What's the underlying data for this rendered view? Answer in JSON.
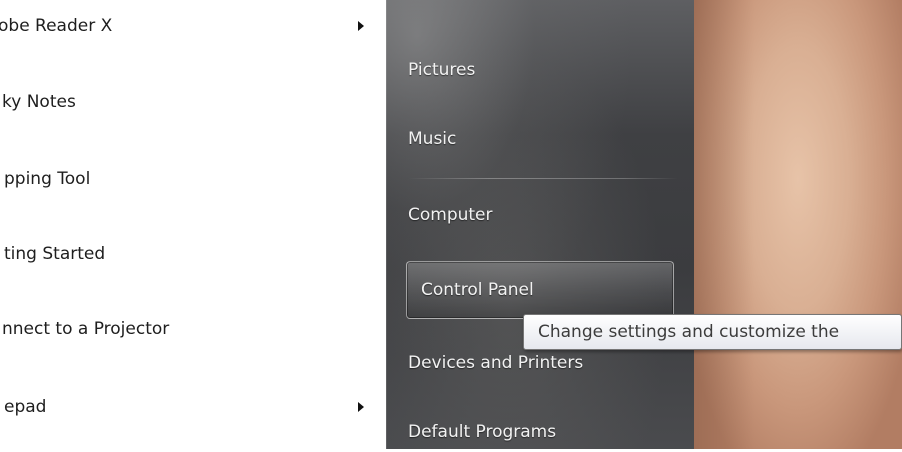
{
  "programs": {
    "items": [
      {
        "label": "obe Reader X",
        "has_submenu": true
      },
      {
        "label": "ky Notes",
        "has_submenu": false
      },
      {
        "label": "pping Tool",
        "has_submenu": false
      },
      {
        "label": "ting Started",
        "has_submenu": false
      },
      {
        "label": "nnect to a Projector",
        "has_submenu": false
      },
      {
        "label": "epad",
        "has_submenu": true
      }
    ]
  },
  "places": {
    "items": [
      {
        "label": "Pictures"
      },
      {
        "label": "Music"
      },
      {
        "label": "Computer"
      },
      {
        "label": "Control Panel",
        "highlighted": true
      },
      {
        "label": "Devices and Printers"
      },
      {
        "label": "Default Programs"
      }
    ]
  },
  "tooltip": {
    "text": "Change settings and customize the"
  },
  "colors": {
    "right_pane_bg": "#3f4043",
    "text_dark": "#1e1e1e",
    "text_light": "#f2f2f2",
    "tooltip_bg": "#e6e8ee"
  }
}
